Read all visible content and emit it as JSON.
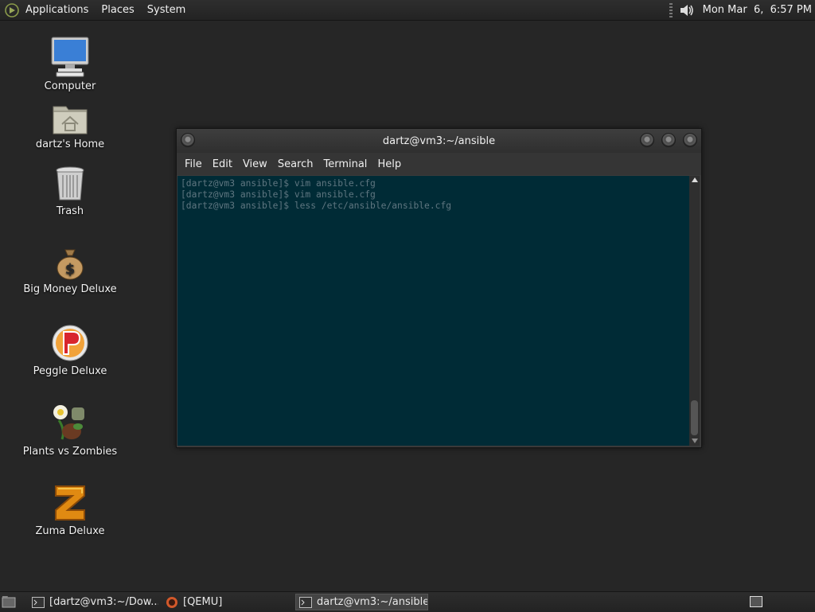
{
  "top_panel": {
    "menus": [
      "Applications",
      "Places",
      "System"
    ],
    "clock": "Mon Mar  6,  6:57 PM"
  },
  "desktop_icons": [
    {
      "label": "Computer",
      "icon": "computer-icon"
    },
    {
      "label": "dartz's Home",
      "icon": "home-folder-icon"
    },
    {
      "label": "Trash",
      "icon": "trash-icon"
    },
    {
      "label": "Big Money Deluxe",
      "icon": "money-bag-icon"
    },
    {
      "label": "Peggle Deluxe",
      "icon": "peggle-icon"
    },
    {
      "label": "Plants vs Zombies",
      "icon": "plants-vs-zombies-icon"
    },
    {
      "label": "Zuma Deluxe",
      "icon": "zuma-icon"
    }
  ],
  "terminal": {
    "title": "dartz@vm3:~/ansible",
    "menu": [
      "File",
      "Edit",
      "View",
      "Search",
      "Terminal",
      "Help"
    ],
    "lines": [
      "[dartz@vm3 ansible]$ vim ansible.cfg",
      "[dartz@vm3 ansible]$ vim ansible.cfg",
      "[dartz@vm3 ansible]$ less /etc/ansible/ansible.cfg"
    ],
    "background": "#002b36",
    "foreground": "#5f7680"
  },
  "taskbar": {
    "tasks": [
      {
        "label": "[dartz@vm3:~/Dow...",
        "icon": "terminal-icon",
        "active": false
      },
      {
        "label": "[QEMU]",
        "icon": "qemu-icon",
        "active": false
      },
      {
        "label": "dartz@vm3:~/ansible",
        "icon": "terminal-icon",
        "active": true
      }
    ]
  }
}
